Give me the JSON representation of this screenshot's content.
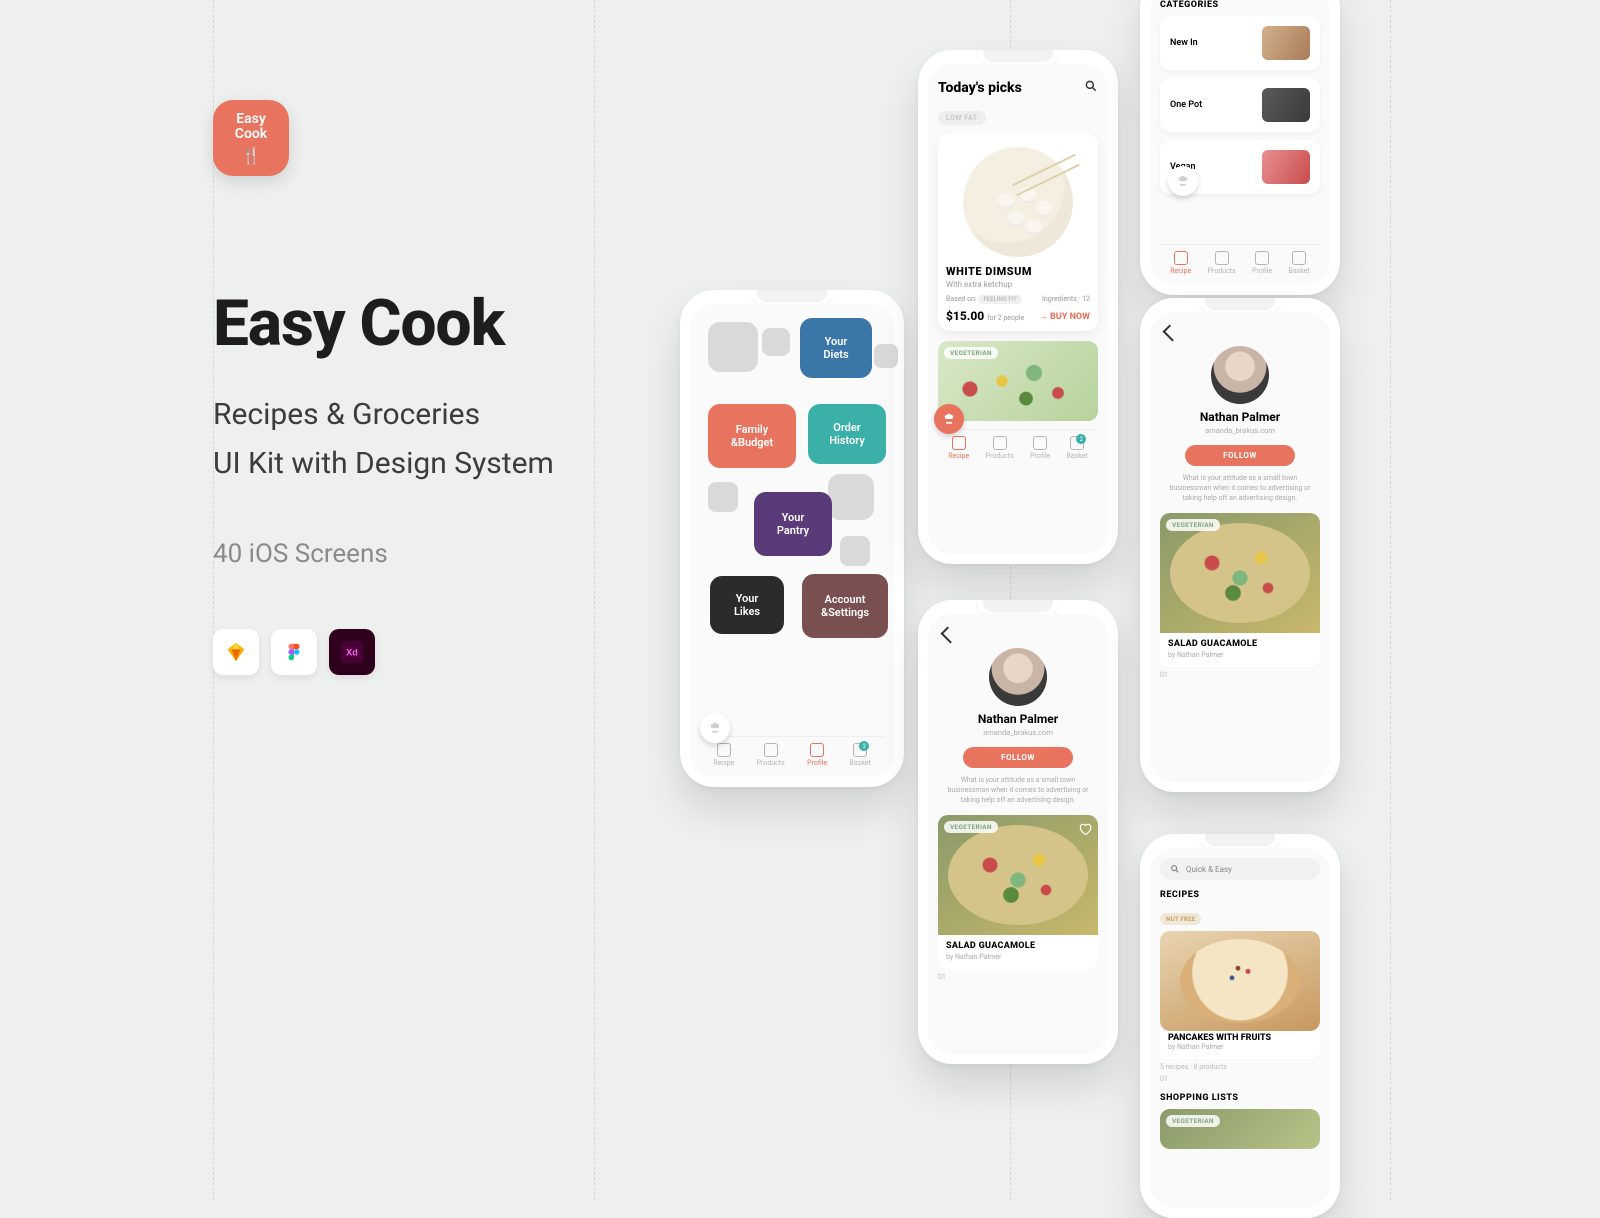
{
  "brand": {
    "icon_label_1": "Easy",
    "icon_label_2": "Cook",
    "title": "Easy Cook",
    "subtitle_1": "Recipes & Groceries",
    "subtitle_2": "UI Kit with Design System",
    "screens_line": "40 iOS Screens"
  },
  "tools": [
    "Sketch",
    "Figma",
    "Adobe XD"
  ],
  "tabbar": {
    "recipe": "Recipe",
    "products": "Products",
    "profile": "Profile",
    "basket": "Basket",
    "badge": "2"
  },
  "phone1": {
    "tiles": {
      "diets": "Your\nDiets",
      "family": "Family\n&Budget",
      "order": "Order\nHistory",
      "pantry": "Your\nPantry",
      "likes": "Your\nLikes",
      "account": "Account\n&Settings"
    }
  },
  "phone2": {
    "header": "Today's picks",
    "low_fat": "LOW FAT",
    "card": {
      "title": "WHITE DIMSUM",
      "subtitle": "With extra ketchup",
      "based_label": "Based on:",
      "based_pill": "FEELING FIT",
      "ingredients": "Ingredients · 12",
      "price": "$15.00",
      "price_sub": "for 2 people",
      "buy": "→ BUY NOW"
    },
    "veg_badge": "VEGETERIAN"
  },
  "profile": {
    "name": "Nathan Palmer",
    "email": "amanda_brakus.com",
    "follow": "FOLLOW",
    "bio": "What is your attitude as a small town businessman when it comes to advertising or taking help off an advertising design.",
    "bio_short": "What is your attitude as a small town businessman when it comes to advertising or taking help off an advertising design.",
    "card_title": "SALAD GUACAMOLE",
    "card_author": "by Nathan Palmer",
    "page": "01"
  },
  "categories": {
    "header": "CATEGORIES",
    "items": [
      "New In",
      "One Pot",
      "Vegan"
    ]
  },
  "search": {
    "placeholder": "Quick & Easy",
    "recipes_h": "RECIPES",
    "chip": "NUT FREE",
    "card_title": "PANCAKES WITH FRUITS",
    "card_author": "by Nathan Palmer",
    "meta": "5 recipes · 8 products",
    "shopping_h": "SHOPPING LISTS",
    "veg": "VEGETERIAN",
    "page": "01"
  }
}
